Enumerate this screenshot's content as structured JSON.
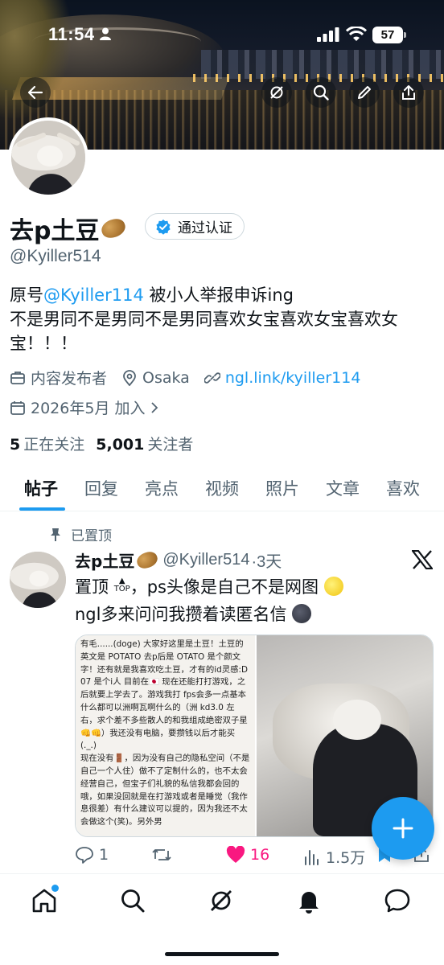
{
  "status_bar": {
    "time": "11:54",
    "battery": "57"
  },
  "profile": {
    "display_name": "去p土豆",
    "verify_label": "通过认证",
    "handle": "@Kyiller514",
    "bio_line1_prefix": "原号",
    "bio_mention": "@Kyiller114",
    "bio_line1_suffix": " 被小人举报申诉ing",
    "bio_line2": "不是男同不是男同不是男同喜欢女宝喜欢女宝喜欢女宝！！！",
    "category": "内容发布者",
    "location": "Osaka",
    "link": "ngl.link/kyiller114",
    "joined": "2026年5月 加入",
    "following_count": "5",
    "following_label": "正在关注",
    "followers_count": "5,001",
    "followers_label": "关注者"
  },
  "tabs": [
    "帖子",
    "回复",
    "亮点",
    "视频",
    "照片",
    "文章",
    "喜欢"
  ],
  "post": {
    "pinned_label": "已置顶",
    "author_name": "去p土豆",
    "author_handle": "@Kyiller514",
    "time": "·3天",
    "text_line1_a": "置顶",
    "text_line1_b": "，ps头像是自己不是网图",
    "text_line2": "ngl多来问问我攒着读匿名信",
    "top_emoji_label": "TOP",
    "image_text": "有毛......(doge) 大家好这里是土豆！土豆的英文是 POTATO 去p后是 OTATO 是个颜文字！还有就是我喜欢吃土豆，才有的id灵感:D\n07 是个i人 目前在🇯🇵 现在还能打打游戏，之后就要上学去了。游戏我打 fps会多一点基本什么都可以洲啊瓦啊什么的（洲 kd3.0 左右，求个差不多些散人的和我组成绝密双子星👊👊）我还没有电脑，要攒钱以后才能买 (._.)\n现在没有🚪，因为没有自己的隐私空间（不是自己一个人住）做不了定制什么的，也不太会经营自己，但宝子们礼貌的私信我都会回的哦，如果没回就是在打游戏或者是睡觉（我作息很差）有什么建议可以提的，因为我还不太会做这个(笑)。另外男",
    "replies": "1",
    "likes": "16",
    "views": "1.5万"
  },
  "colors": {
    "accent": "#1d9bf0",
    "like": "#f91880",
    "text_secondary": "#536471"
  },
  "icons": {
    "header": [
      "back-arrow-icon",
      "grok-icon",
      "search-icon",
      "edit-icon",
      "share-icon"
    ],
    "nav": [
      "home-icon",
      "search-icon",
      "grok-icon",
      "notifications-bell-icon",
      "messages-icon"
    ]
  }
}
